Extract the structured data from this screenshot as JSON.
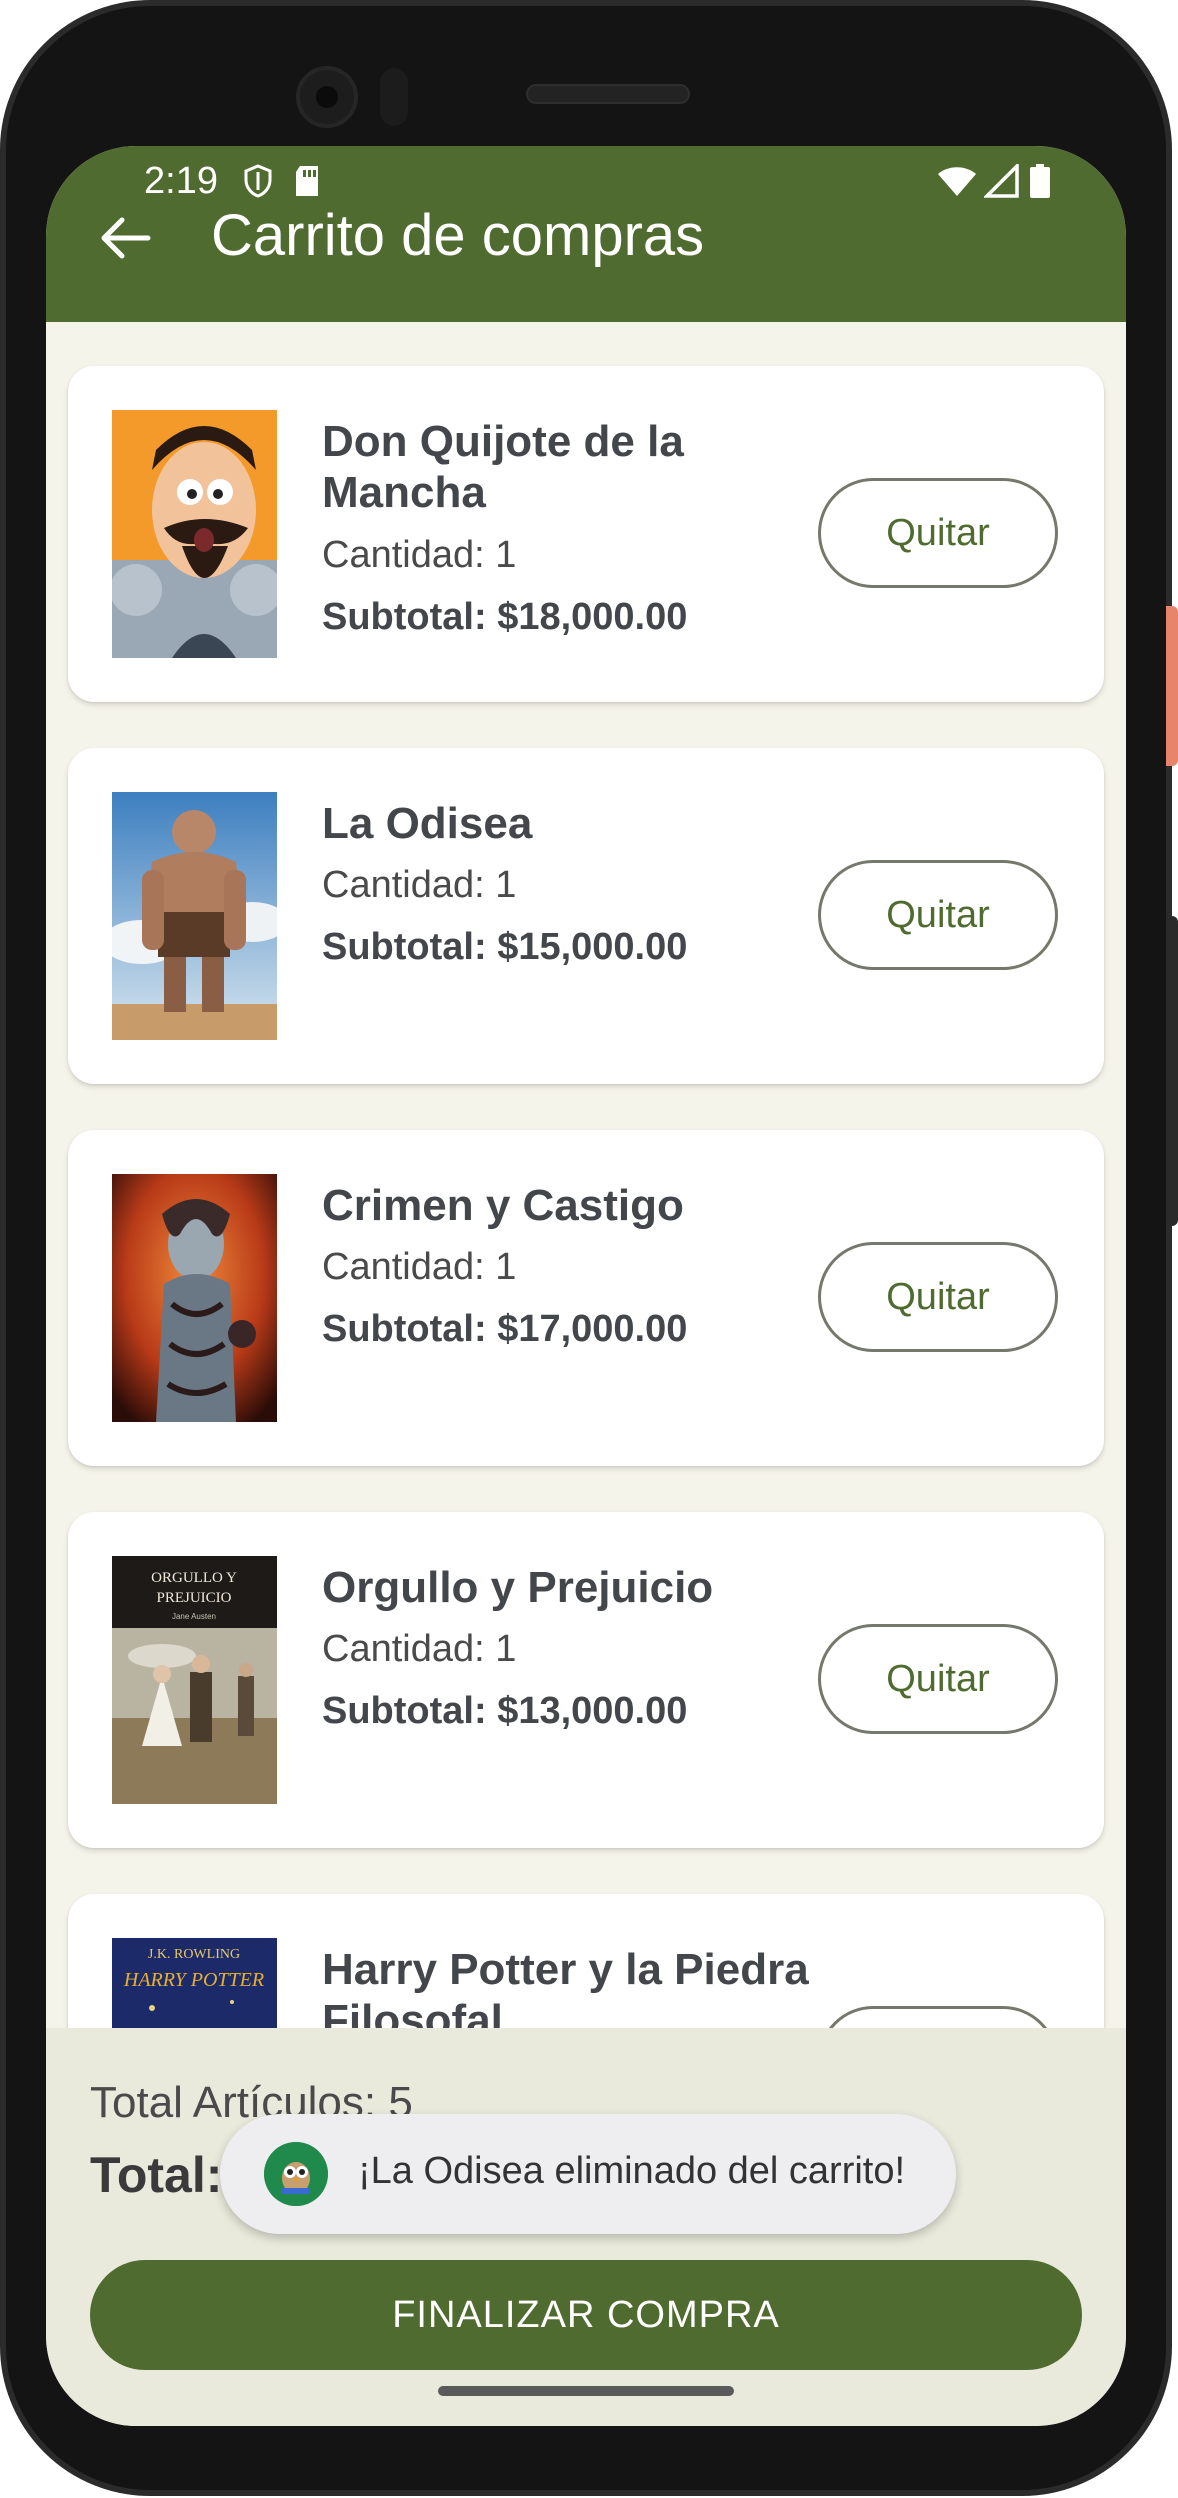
{
  "status_bar": {
    "time": "2:19",
    "icons": [
      "shield-icon",
      "sd-card-icon",
      "wifi-icon",
      "signal-icon",
      "battery-icon"
    ]
  },
  "app_bar": {
    "back_icon": "arrow-left-icon",
    "title": "Carrito de compras",
    "color": "#4f6b30"
  },
  "cart": {
    "items": [
      {
        "title": "Don Quijote de la Mancha",
        "quantity": "Cantidad: 1",
        "subtotal": "Subtotal: $18,000.00",
        "remove_label": "Quitar"
      },
      {
        "title": "La Odisea",
        "quantity": "Cantidad: 1",
        "subtotal": "Subtotal: $15,000.00",
        "remove_label": "Quitar"
      },
      {
        "title": "Crimen y Castigo",
        "quantity": "Cantidad: 1",
        "subtotal": "Subtotal: $17,000.00",
        "remove_label": "Quitar"
      },
      {
        "title": "Orgullo y Prejuicio",
        "quantity": "Cantidad: 1",
        "subtotal": "Subtotal: $13,000.00",
        "remove_label": "Quitar"
      },
      {
        "title": "Harry Potter y la Piedra Filosofal",
        "quantity": "",
        "subtotal": "",
        "remove_label": ""
      }
    ]
  },
  "covers": {
    "orgullo_line1": "ORGULLO Y",
    "orgullo_line2": "PREJUICIO",
    "orgullo_author": "Jane Austen",
    "hp_author": "J.K. ROWLING",
    "hp_title": "HARRY POTTER"
  },
  "summary": {
    "total_items": "Total Artículos: 5",
    "total_label": "Total:",
    "checkout_label": "FINALIZAR COMPRA"
  },
  "toast": {
    "message": "¡La Odisea eliminado del carrito!",
    "icon": "owl-app-icon"
  }
}
